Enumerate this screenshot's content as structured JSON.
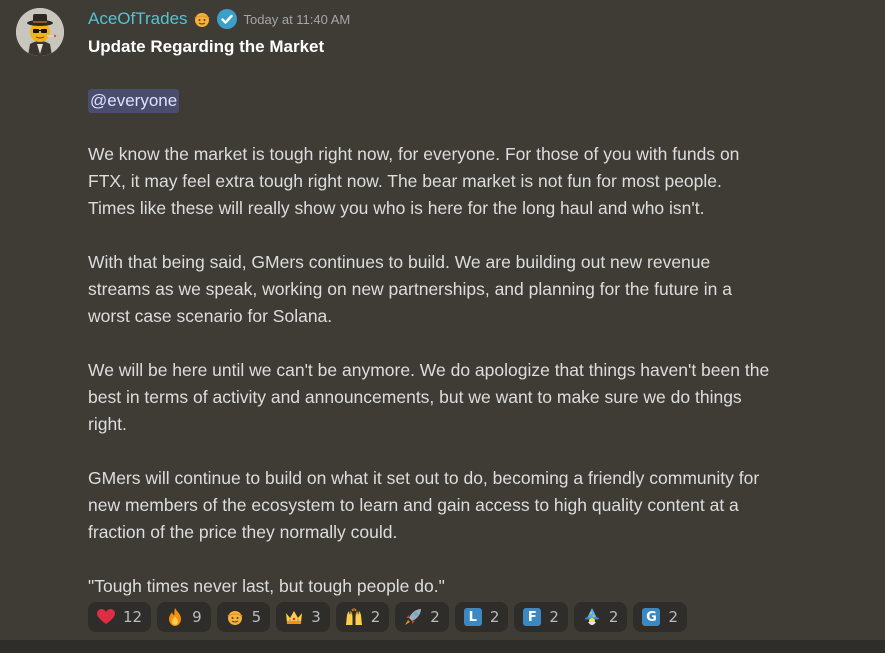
{
  "message": {
    "username": "AceOfTrades",
    "timestamp": "Today at 11:40 AM",
    "title": "Update Regarding the Market",
    "mention": "@everyone",
    "paragraphs": [
      [
        "We know the market is tough right now, for everyone.  For those of you with funds on",
        "FTX, it may feel extra tough right now.  The bear market is not fun for most people.",
        "Times like these will really show you who is here for the long haul and who isn't."
      ],
      [
        "With that being said, GMers continues to build.  We are building out new revenue",
        "streams as we speak,  working on new partnerships, and planning for the future in a",
        "worst case scenario for Solana."
      ],
      [
        "We will be here until we can't be anymore.  We do apologize that things haven't been the",
        "best in terms of activity and announcements, but we want to make sure we do things",
        "right."
      ],
      [
        "GMers will continue to build on what it set out to do, becoming a friendly community for",
        "new members of the ecosystem to learn and gain access to high quality content at a",
        "fraction of the price they normally could."
      ],
      [
        "\"Tough times never last, but tough people do.\""
      ]
    ]
  },
  "reactions": [
    {
      "icon": "heart-icon",
      "count": "12"
    },
    {
      "icon": "fire-icon",
      "count": "9"
    },
    {
      "icon": "cowboy-sun-icon",
      "count": "5"
    },
    {
      "icon": "crown-icon",
      "count": "3"
    },
    {
      "icon": "raised-hands-icon",
      "count": "2"
    },
    {
      "icon": "rocket-icon",
      "count": "2"
    },
    {
      "icon": "letter-l-icon",
      "letter": "L",
      "count": "2"
    },
    {
      "icon": "letter-f-icon",
      "letter": "F",
      "count": "2"
    },
    {
      "icon": "wizard-icon",
      "count": "2"
    },
    {
      "icon": "letter-g-icon",
      "letter": "G",
      "count": "2"
    }
  ],
  "colors": {
    "background": "#3f3c36",
    "username": "#55c3d6",
    "mention_bg": "#4b4d6f",
    "reaction_bg": "#2f2d29"
  }
}
